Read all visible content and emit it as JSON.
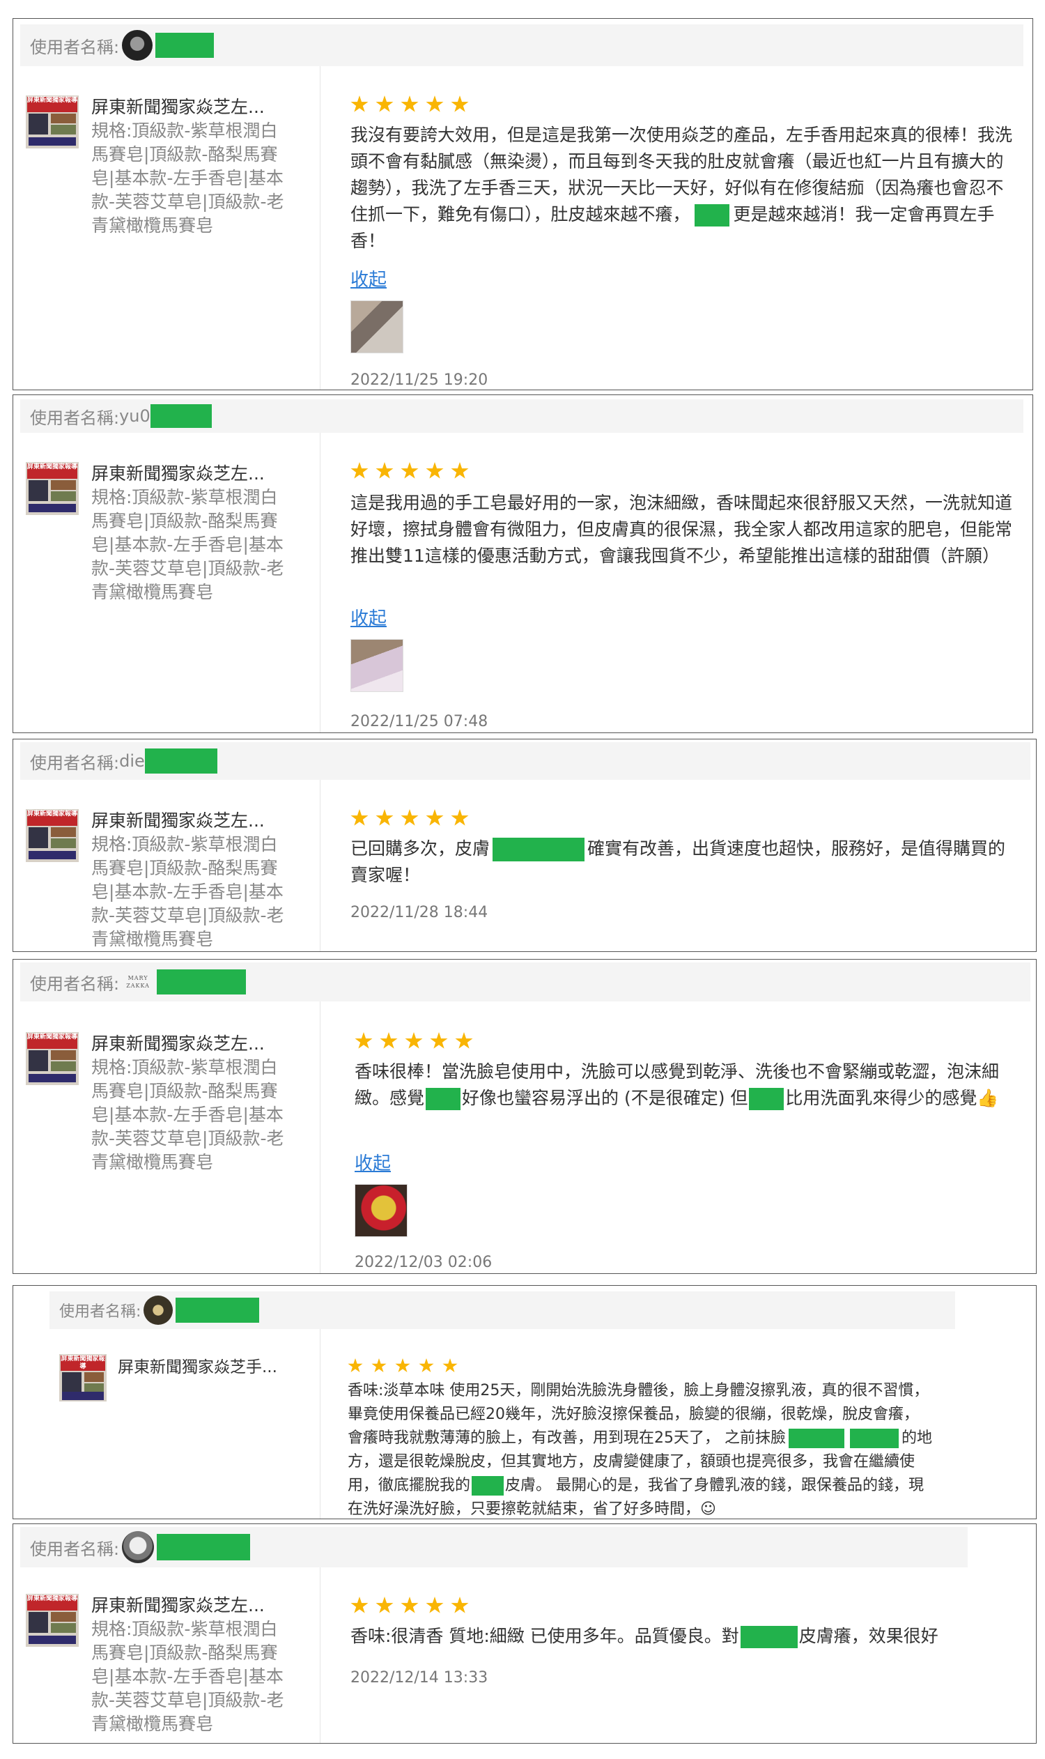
{
  "user_label": "使用者名稱:",
  "collapse_label": "收起",
  "reviews": [
    {
      "username": "",
      "product_title": "屏東新聞獨家焱芝左...",
      "product_spec": "規格:頂級款-紫草根潤白馬賽皂|頂級款-酪梨馬賽皂|基本款-左手香皂|基本款-芙蓉艾草皂|頂級款-老青黛橄欖馬賽皂",
      "rating": 5,
      "text_parts": [
        "我沒有要誇大效用，但是這是我第一次使用焱芝的產品，左手香用起來真的很棒！我洗頭不會有黏膩感（無染燙），而且每到冬天我的肚皮就會癢（最近也紅一片且有擴大的趨勢），我洗了左手香三天，狀況一天比一天好，好似有在修復結痂（因為癢也會忍不住抓一下，難免有傷口），肚皮越來越不癢，",
        "更是越來越消！我一定會再買左手香！"
      ],
      "date": "2022/11/25 19:20"
    },
    {
      "username": "yu0",
      "product_title": "屏東新聞獨家焱芝左...",
      "product_spec": "規格:頂級款-紫草根潤白馬賽皂|頂級款-酪梨馬賽皂|基本款-左手香皂|基本款-芙蓉艾草皂|頂級款-老青黛橄欖馬賽皂",
      "rating": 5,
      "text": "這是我用過的手工皂最好用的一家，泡沫細緻，香味聞起來很舒服又天然，一洗就知道好壞，擦拭身體會有微阻力，但皮膚真的很保濕，我全家人都改用這家的肥皂，但能常推出雙11這樣的優惠活動方式，會讓我囤貨不少，希望能推出這樣的甜甜價（許願）",
      "date": "2022/11/25 07:48"
    },
    {
      "username": "die",
      "product_title": "屏東新聞獨家焱芝左...",
      "product_spec": "規格:頂級款-紫草根潤白馬賽皂|頂級款-酪梨馬賽皂|基本款-左手香皂|基本款-芙蓉艾草皂|頂級款-老青黛橄欖馬賽皂",
      "rating": 5,
      "text_parts": [
        "已回購多次，皮膚",
        "確實有改善，出貨速度也超快，服務好，是值得購買的賣家喔！"
      ],
      "date": "2022/11/28 18:44"
    },
    {
      "username": "",
      "brand_logo": "MARY ZAKKA",
      "product_title": "屏東新聞獨家焱芝左...",
      "product_spec": "規格:頂級款-紫草根潤白馬賽皂|頂級款-酪梨馬賽皂|基本款-左手香皂|基本款-芙蓉艾草皂|頂級款-老青黛橄欖馬賽皂",
      "rating": 5,
      "text_parts": [
        "香味很棒！當洗臉皂使用中，洗臉可以感覺到乾淨、洗後也不會緊繃或乾澀，泡沫細緻。感覺",
        "好像也蠻容易浮出的 (不是很確定) 但",
        "比用洗面乳來得少的感覺👍"
      ],
      "date": "2022/12/03 02:06"
    },
    {
      "username": "",
      "product_title": "屏東新聞獨家焱芝手...",
      "rating": 5,
      "text_parts": [
        "香味:淡草本味 使用25天，剛開始洗臉洗身體後，臉上身體沒擦乳液，真的很不習慣，畢竟使用保養品已經20幾年，洗好臉沒擦保養品，臉變的很繃，很乾燥，脫皮會癢，會癢時我就敷薄薄的臉上，有改善，用到現在25天了， 之前抹臉",
        "的地方，還是很乾燥脫皮，但其實地方，皮膚變健康了，額頭也提亮很多，我會在繼續使用，徹底擺脫我的",
        "皮膚。 最開心的是，我省了身體乳液的錢，跟保養品的錢，現在洗好澡洗好臉，只要擦乾就結束，省了好多時間，☺"
      ]
    },
    {
      "username": "",
      "product_title": "屏東新聞獨家焱芝左...",
      "product_spec": "規格:頂級款-紫草根潤白馬賽皂|頂級款-酪梨馬賽皂|基本款-左手香皂|基本款-芙蓉艾草皂|頂級款-老青黛橄欖馬賽皂",
      "rating": 5,
      "text_parts": [
        "香味:很清香 質地:細緻 已使用多年。品質優良。對",
        "皮膚癢，效果很好"
      ],
      "date": "2022/12/14 13:33"
    }
  ],
  "thumb_text": "屏東新聞獨家報導",
  "colors": {
    "star": "#f9b504",
    "redaction": "#22b24c",
    "link": "#2b7bd6"
  }
}
